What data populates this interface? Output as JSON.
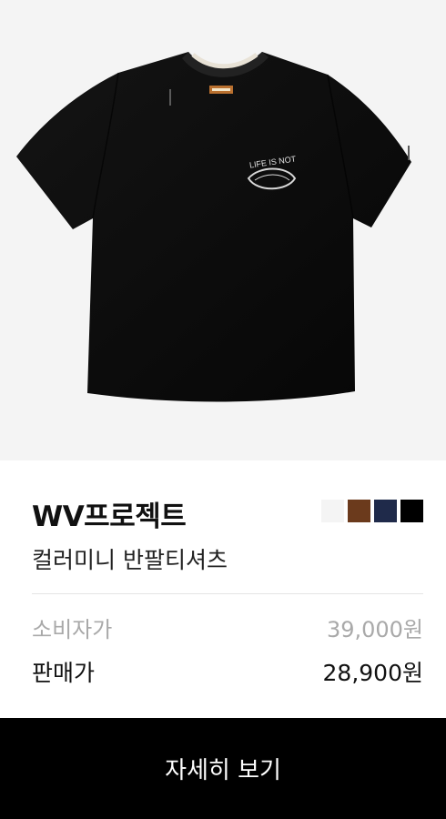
{
  "product": {
    "image_alt": "black short sleeve t-shirt",
    "print_text": "LIFE IS NOT",
    "brand": "WV프로젝트",
    "name": "컬러미니 반팔티셔츠",
    "colors": [
      "#f4f4f4",
      "#6b3a1c",
      "#1f2a4a",
      "#000000"
    ]
  },
  "prices": {
    "retail_label": "소비자가",
    "retail_value": "39,000원",
    "sale_label": "판매가",
    "sale_value": "28,900원"
  },
  "cta": {
    "detail_label": "자세히 보기"
  }
}
